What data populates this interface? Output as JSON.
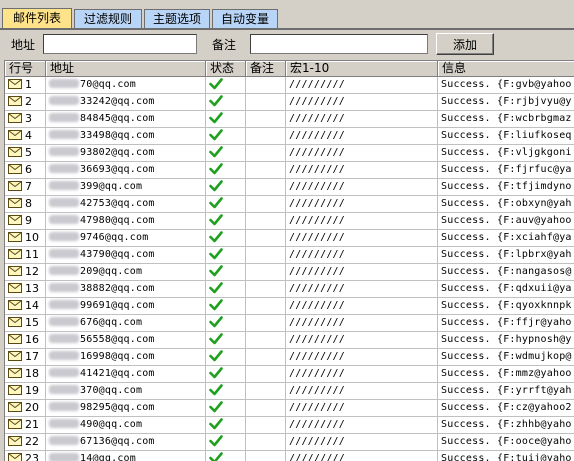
{
  "tabs": [
    {
      "label": "邮件列表",
      "active": true
    },
    {
      "label": "过滤规则",
      "active": false
    },
    {
      "label": "主题选项",
      "active": false
    },
    {
      "label": "自动变量",
      "active": false
    }
  ],
  "address_row": {
    "address_label": "地址",
    "address_value": "",
    "note_label": "备注",
    "note_value": "",
    "add_button": "添加"
  },
  "columns": {
    "row_no": "行号",
    "address": "地址",
    "status": "状态",
    "note": "备注",
    "macro": "宏1-10",
    "info": "信息"
  },
  "colors": {
    "status_ok": "#1fa01f",
    "active_tab": "#ffe38a",
    "inactive_tab": "#b8d4f6"
  },
  "rows": [
    {
      "no": "1",
      "address": "70@qq.com",
      "status": "ok",
      "macro": "/////////",
      "info": "Success. {F:gvb@yahoo"
    },
    {
      "no": "2",
      "address": "33242@qq.com",
      "status": "ok",
      "macro": "/////////",
      "info": "Success. {F:rjbjvyu@y"
    },
    {
      "no": "3",
      "address": "84845@qq.com",
      "status": "ok",
      "macro": "/////////",
      "info": "Success. {F:wcbrbgmaz"
    },
    {
      "no": "4",
      "address": "33498@qq.com",
      "status": "ok",
      "macro": "/////////",
      "info": "Success. {F:liufkoseq"
    },
    {
      "no": "5",
      "address": "93802@qq.com",
      "status": "ok",
      "macro": "/////////",
      "info": "Success. {F:vljgkgoni"
    },
    {
      "no": "6",
      "address": "36693@qq.com",
      "status": "ok",
      "macro": "/////////",
      "info": "Success. {F:fjrfuc@ya"
    },
    {
      "no": "7",
      "address": "399@qq.com",
      "status": "ok",
      "macro": "/////////",
      "info": "Success. {F:tfjimdyno"
    },
    {
      "no": "8",
      "address": "42753@qq.com",
      "status": "ok",
      "macro": "/////////",
      "info": "Success. {F:obxyn@yah"
    },
    {
      "no": "9",
      "address": "47980@qq.com",
      "status": "ok",
      "macro": "/////////",
      "info": "Success. {F:auv@yahoo"
    },
    {
      "no": "10",
      "address": "9746@qq.com",
      "status": "ok",
      "macro": "/////////",
      "info": "Success. {F:xciahf@ya"
    },
    {
      "no": "11",
      "address": "43790@qq.com",
      "status": "ok",
      "macro": "/////////",
      "info": "Success. {F:lpbrx@yah"
    },
    {
      "no": "12",
      "address": "209@qq.com",
      "status": "ok",
      "macro": "/////////",
      "info": "Success. {F:nangasos@"
    },
    {
      "no": "13",
      "address": "38882@qq.com",
      "status": "ok",
      "macro": "/////////",
      "info": "Success. {F:qdxuii@ya"
    },
    {
      "no": "14",
      "address": "99691@qq.com",
      "status": "ok",
      "macro": "/////////",
      "info": "Success. {F:qyoxknnpk"
    },
    {
      "no": "15",
      "address": "676@qq.com",
      "status": "ok",
      "macro": "/////////",
      "info": "Success. {F:ffjr@yaho"
    },
    {
      "no": "16",
      "address": "56558@qq.com",
      "status": "ok",
      "macro": "/////////",
      "info": "Success. {F:hypnosh@y"
    },
    {
      "no": "17",
      "address": "16998@qq.com",
      "status": "ok",
      "macro": "/////////",
      "info": "Success. {F:wdmujkop@"
    },
    {
      "no": "18",
      "address": "41421@qq.com",
      "status": "ok",
      "macro": "/////////",
      "info": "Success. {F:mmz@yahoo"
    },
    {
      "no": "19",
      "address": "370@qq.com",
      "status": "ok",
      "macro": "/////////",
      "info": "Success. {F:yrrft@yah"
    },
    {
      "no": "20",
      "address": "98295@qq.com",
      "status": "ok",
      "macro": "/////////",
      "info": "Success. {F:cz@yahoo2"
    },
    {
      "no": "21",
      "address": "490@qq.com",
      "status": "ok",
      "macro": "/////////",
      "info": "Success. {F:zhhb@yaho"
    },
    {
      "no": "22",
      "address": "67136@qq.com",
      "status": "ok",
      "macro": "/////////",
      "info": "Success. {F:ooce@yaho"
    },
    {
      "no": "23",
      "address": "14@qq.com",
      "status": "ok",
      "macro": "/////////",
      "info": "Success. {F:tuij@yaho"
    }
  ]
}
